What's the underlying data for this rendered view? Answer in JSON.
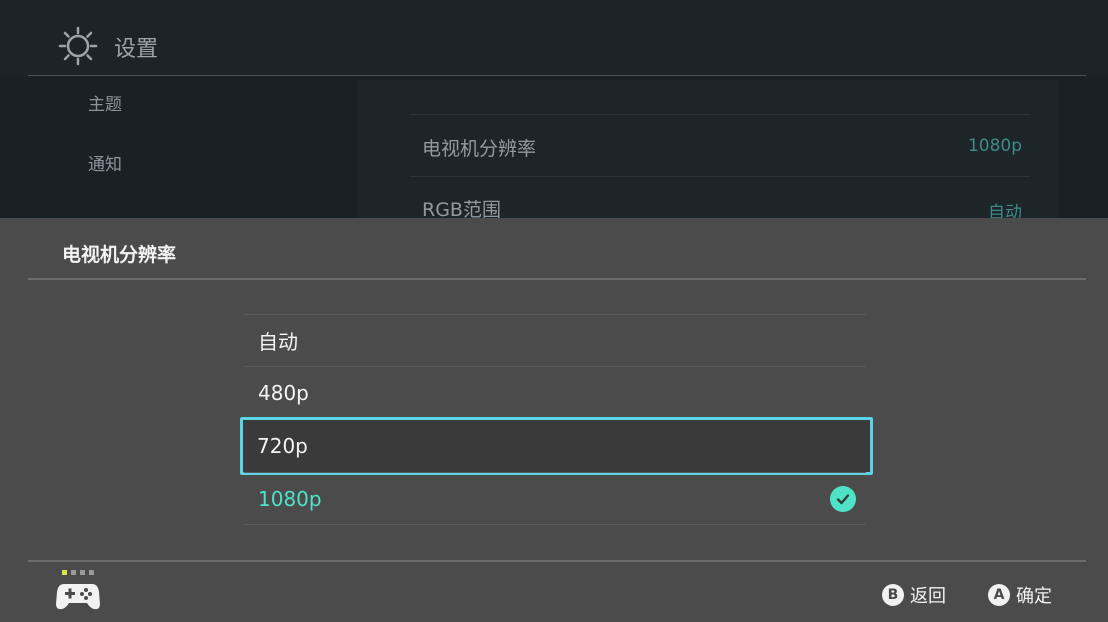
{
  "header": {
    "title": "设置",
    "icon": "gear-icon"
  },
  "sidebar": {
    "items": [
      {
        "label": "主题"
      },
      {
        "label": "通知"
      }
    ]
  },
  "settings_rows": [
    {
      "label": "电视机分辨率",
      "value": "1080p"
    },
    {
      "label": "RGB范围",
      "value": "自动"
    }
  ],
  "dialog": {
    "title": "电视机分辨率",
    "options": [
      {
        "label": "自动"
      },
      {
        "label": "480p"
      },
      {
        "label": "720p"
      },
      {
        "label": "1080p"
      }
    ],
    "highlighted_option": "720p",
    "current_option": "1080p"
  },
  "footer": {
    "back_key": "B",
    "back_label": "返回",
    "confirm_key": "A",
    "confirm_label": "确定"
  },
  "colors": {
    "accent": "#4ee2c6",
    "focus_border": "#5bd4e6",
    "panel_bg": "#4b4b4b",
    "screen_bg": "#1a2024"
  }
}
